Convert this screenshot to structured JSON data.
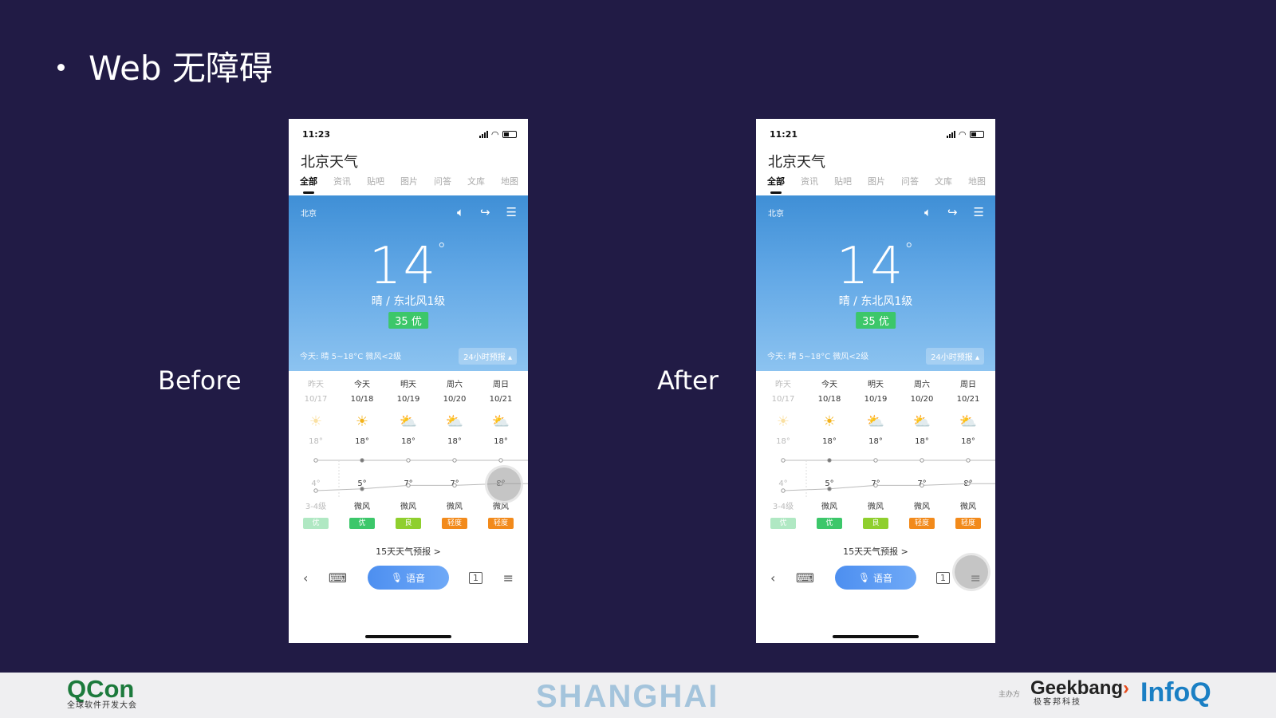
{
  "slide": {
    "title": "Web 无障碍",
    "label_before": "Before",
    "label_after": "After"
  },
  "phones": [
    {
      "time": "11:23",
      "touch_position": "right of Sunday temperature chart"
    },
    {
      "time": "11:21",
      "touch_position": "below Sunday air-quality badge"
    }
  ],
  "weather": {
    "page_title": "北京天气",
    "tabs": [
      "全部",
      "资讯",
      "贴吧",
      "图片",
      "问答",
      "文库",
      "地图"
    ],
    "city": "北京",
    "temperature": "14",
    "degree": "°",
    "condition": "晴 / 东北风1级",
    "aqi": "35 优",
    "today_summary": "今天: 晴 5~18°C 微风<2级",
    "hourly_button": "24小时预报 ▴",
    "days": [
      {
        "name": "昨天",
        "date": "10/17",
        "high": "18°",
        "low": "4°",
        "wind": "3-4级",
        "quality": "优",
        "quality_level": "you",
        "past": true
      },
      {
        "name": "今天",
        "date": "10/18",
        "high": "18°",
        "low": "5°",
        "wind": "微风",
        "quality": "优",
        "quality_level": "you",
        "past": false
      },
      {
        "name": "明天",
        "date": "10/19",
        "high": "18°",
        "low": "7°",
        "wind": "微风",
        "quality": "良",
        "quality_level": "liang",
        "past": false
      },
      {
        "name": "周六",
        "date": "10/20",
        "high": "18°",
        "low": "7°",
        "wind": "微风",
        "quality": "轻度",
        "quality_level": "qing",
        "past": false
      },
      {
        "name": "周日",
        "date": "10/21",
        "high": "18°",
        "low": "8°",
        "wind": "微风",
        "quality": "轻度",
        "quality_level": "qing",
        "past": false
      }
    ],
    "forecast_15": "15天天气预报 >",
    "voice_button": "语音",
    "tab_count": "1"
  },
  "footer": {
    "qcon": "QCon",
    "qcon_sub": "全球软件开发大会",
    "city": "SHANGHAI",
    "organizer_label": "主办方",
    "geekbang": "Geekbang",
    "geekbang_sub": "极客邦科技",
    "infoq": "InfoQ"
  },
  "colors": {
    "background": "#211b45",
    "sky_top": "#3f8fd6",
    "aqi_green": "#3cc76a",
    "quality_light": "#f28a1b",
    "voice_blue": "#4d8ff0"
  }
}
